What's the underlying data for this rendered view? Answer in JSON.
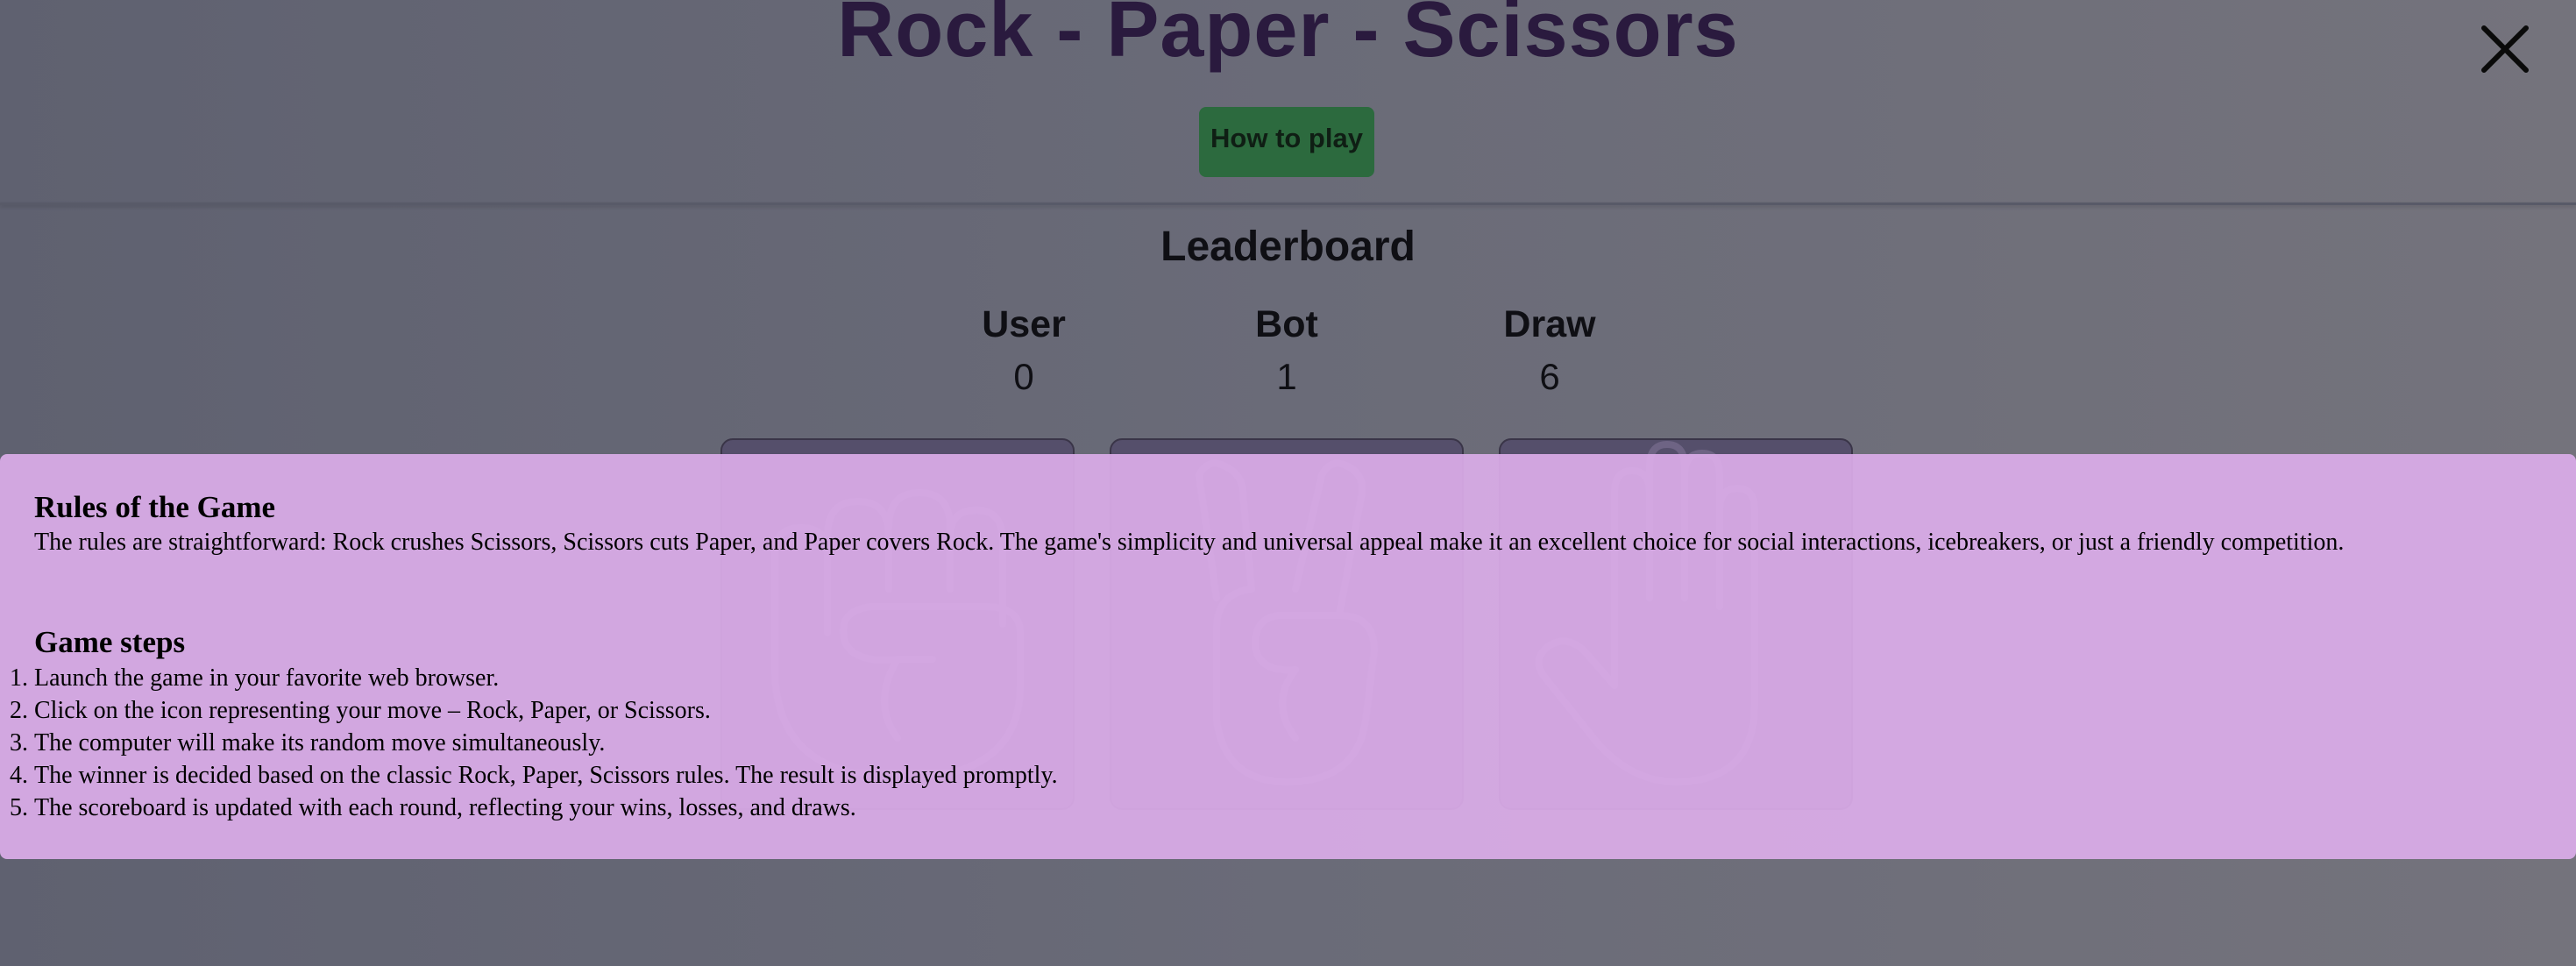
{
  "header": {
    "title": "Rock - Paper - Scissors",
    "how_to_play_label": "How to play",
    "close_icon": "close-icon"
  },
  "leaderboard": {
    "title": "Leaderboard",
    "columns": [
      {
        "label": "User",
        "value": "0"
      },
      {
        "label": "Bot",
        "value": "1"
      },
      {
        "label": "Draw",
        "value": "6"
      }
    ]
  },
  "choices": [
    {
      "name": "rock",
      "icon": "fist-icon"
    },
    {
      "name": "scissors",
      "icon": "peace-hand-icon"
    },
    {
      "name": "paper",
      "icon": "open-hand-icon"
    }
  ],
  "modal": {
    "rules_heading": "Rules of the Game",
    "rules_text": "The rules are straightforward: Rock crushes Scissors, Scissors cuts Paper, and Paper covers Rock. The game's simplicity and universal appeal make it an excellent choice for social interactions, icebreakers, or just a friendly competition.",
    "steps_heading": "Game steps",
    "steps": [
      "Launch the game in your favorite web browser.",
      "Click on the icon representing your move – Rock, Paper, or Scissors.",
      "The computer will make its random move simultaneously.",
      "The winner is decided based on the classic Rock, Paper, Scissors rules. The result is displayed promptly.",
      "The scoreboard is updated with each round, reflecting your wins, losses, and draws."
    ]
  },
  "colors": {
    "title": "#2a1a3e",
    "how_to_play_button": "#2c6a3e",
    "modal_background": "#daace8",
    "card": "#554f6b"
  }
}
